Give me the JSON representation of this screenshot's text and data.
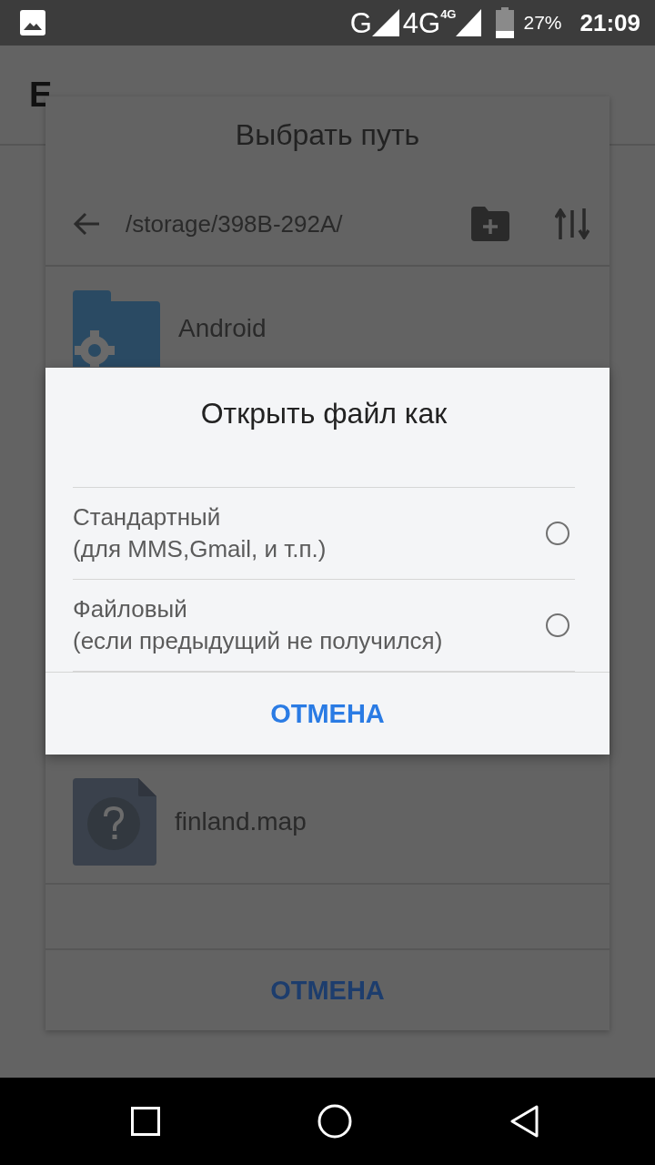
{
  "status_bar": {
    "network_1": "G",
    "network_2": "4G",
    "network_2_badge": "4G",
    "battery": "27%",
    "time": "21:09"
  },
  "app_bar": {
    "title": "E"
  },
  "path_dialog": {
    "title": "Выбрать путь",
    "path": "/storage/398B-292A/",
    "items": [
      {
        "name": "Android",
        "kind": "folder"
      },
      {
        "name": "finland.map",
        "kind": "file"
      }
    ],
    "cancel": "ОТМЕНА"
  },
  "open_as_dialog": {
    "title": "Открыть файл как",
    "options": [
      {
        "title": "Стандартный",
        "subtitle": "(для MMS,Gmail, и т.п.)",
        "selected": false
      },
      {
        "title": "Файловый",
        "subtitle": "(если предыдущий не получился)",
        "selected": false
      }
    ],
    "cancel": "ОТМЕНА"
  }
}
